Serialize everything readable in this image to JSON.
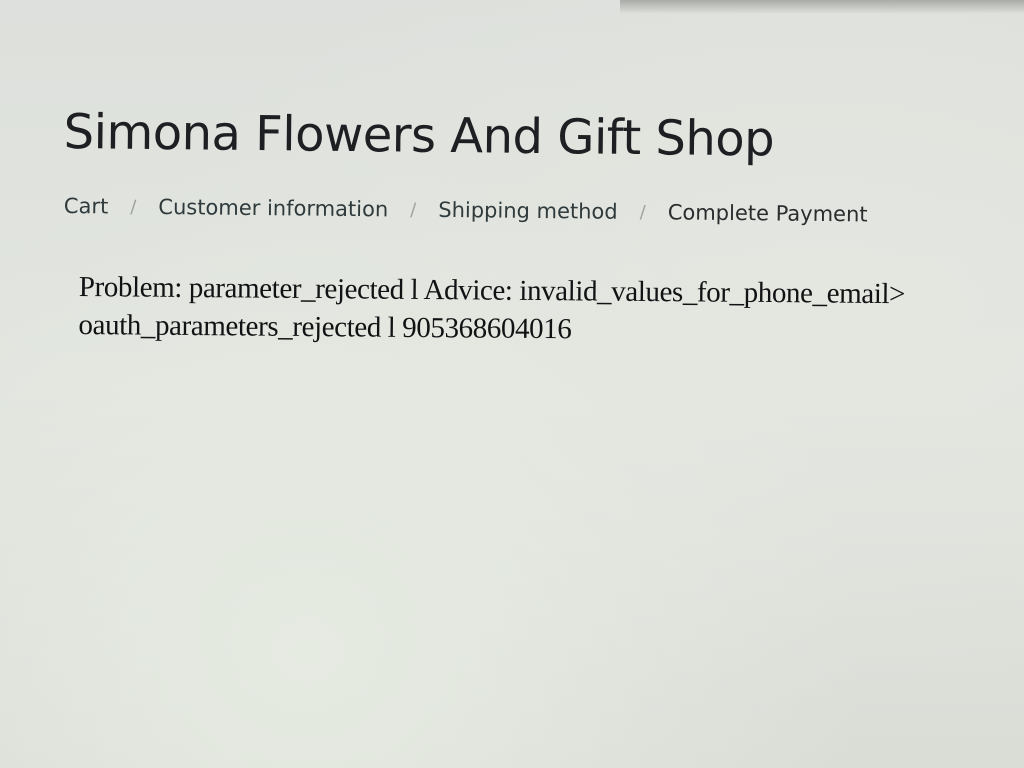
{
  "store": {
    "title": "Simona Flowers And Gift Shop"
  },
  "breadcrumb": {
    "items": [
      {
        "label": "Cart"
      },
      {
        "label": "Customer information"
      },
      {
        "label": "Shipping method"
      },
      {
        "label": "Complete Payment"
      }
    ],
    "separator": "/"
  },
  "error": {
    "line1": "Problem: parameter_rejected l Advice: invalid_values_for_phone_email>",
    "line2": "oauth_parameters_rejected l 905368604016"
  }
}
